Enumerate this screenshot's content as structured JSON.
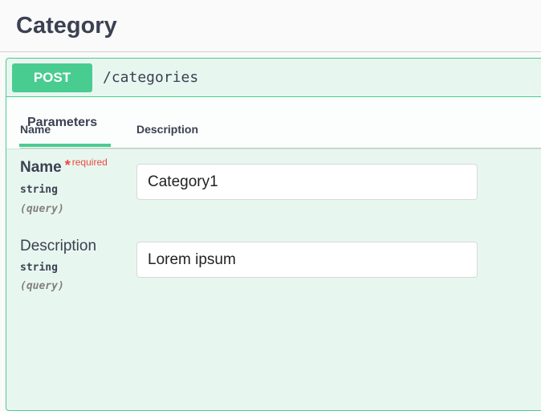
{
  "tag": {
    "title": "Category"
  },
  "operation": {
    "method": "POST",
    "path": "/categories"
  },
  "tabs": {
    "parameters_label": "Parameters"
  },
  "table": {
    "headers": {
      "name": "Name",
      "description": "Description"
    }
  },
  "parameters": [
    {
      "name": "Name",
      "required_marker": "*",
      "required_label": "required",
      "type": "string",
      "in": "(query)",
      "value": "Category1"
    },
    {
      "name": "Description",
      "type": "string",
      "in": "(query)",
      "value": "Lorem ipsum"
    }
  ],
  "colors": {
    "post_green": "#49cc90",
    "required_red": "#e74c3c",
    "text_dark": "#3b4151"
  }
}
